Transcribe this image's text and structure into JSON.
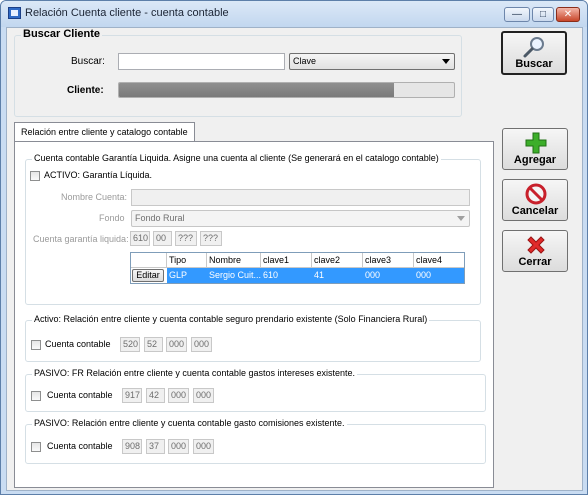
{
  "window": {
    "title": "Relación Cuenta cliente - cuenta contable",
    "minimize": "—",
    "maximize": "□",
    "close": "✕"
  },
  "search": {
    "group_title": "Buscar Cliente",
    "buscar_label": "Buscar:",
    "buscar_value": "",
    "type_selected": "Clave",
    "cliente_label": "Cliente:",
    "progress": 0.82
  },
  "buttons": {
    "buscar": "Buscar",
    "agregar": "Agregar",
    "cancelar": "Cancelar",
    "cerrar": "Cerrar"
  },
  "tab": {
    "label": "Relación entre cliente y catalogo contable"
  },
  "garantia": {
    "group_title": "Cuenta contable Garantía Liquida. Asigne una cuenta al cliente (Se generará en el catalogo contable)",
    "activo_label": "ACTIVO: Garantía Líquida.",
    "nombre_label": "Nombre Cuenta:",
    "nombre_value": "",
    "fondo_label": "Fondo",
    "fondo_value": "Fondo Rural",
    "cuenta_label": "Cuenta garantía liquida:",
    "segments": [
      "610",
      "00",
      "???",
      "???"
    ],
    "grid": {
      "columns": [
        "",
        "Tipo",
        "Nombre",
        "clave1",
        "clave2",
        "clave3",
        "clave4"
      ],
      "rows": [
        {
          "button": "Editar",
          "tipo": "GLP",
          "nombre": "Sergio Cuit...",
          "clave1": "610",
          "clave2": "41",
          "clave3": "000",
          "clave4": "000"
        }
      ]
    }
  },
  "prendario": {
    "group_title": "Activo: Relación entre cliente y cuenta contable seguro prendario existente (Solo Financiera Rural)",
    "check_label": "Cuenta contable",
    "segments": [
      "520",
      "52",
      "000",
      "000"
    ]
  },
  "intereses": {
    "group_title": "PASIVO:  FR Relación entre cliente y cuenta contable gastos intereses existente.",
    "check_label": "Cuenta contable",
    "segments": [
      "917",
      "42",
      "000",
      "000"
    ]
  },
  "comisiones": {
    "group_title": "PASIVO: Relación entre cliente y cuenta contable gasto comisiones existente.",
    "check_label": "Cuenta contable",
    "segments": [
      "908",
      "37",
      "000",
      "000"
    ]
  }
}
